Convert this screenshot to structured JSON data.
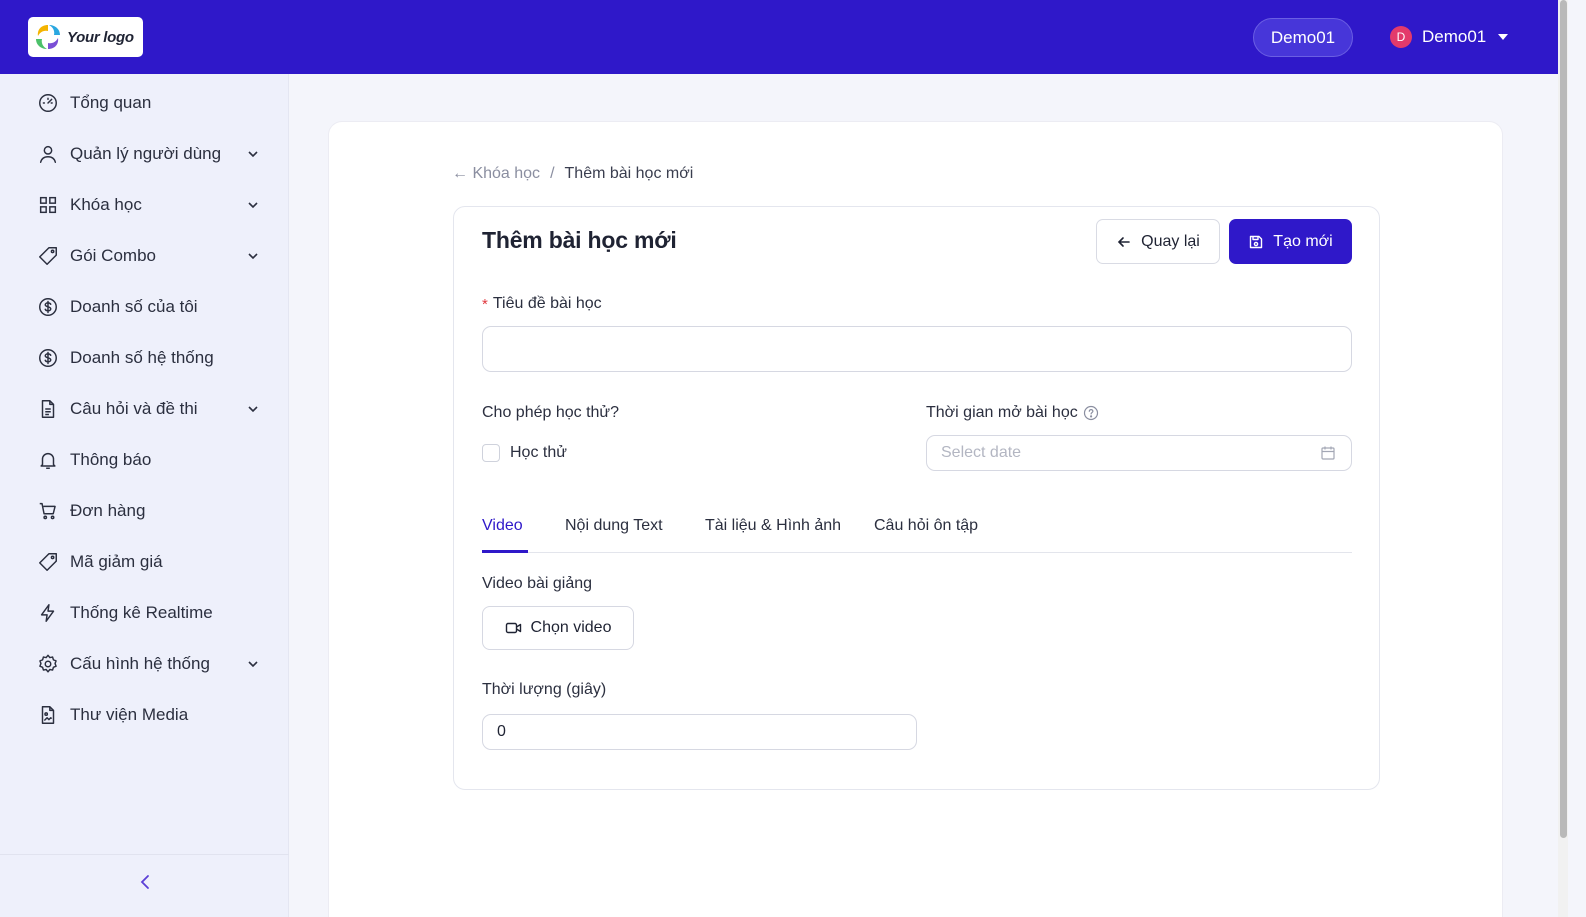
{
  "header": {
    "logo_text": "Your logo",
    "pill_label": "Demo01",
    "user": {
      "initial": "D",
      "name": "Demo01"
    }
  },
  "sidebar": {
    "items": [
      {
        "label": "Tổng quan",
        "icon": "dashboard-icon",
        "expandable": false
      },
      {
        "label": "Quản lý người dùng",
        "icon": "user-icon",
        "expandable": true
      },
      {
        "label": "Khóa học",
        "icon": "grid-icon",
        "expandable": true
      },
      {
        "label": "Gói Combo",
        "icon": "tag-icon",
        "expandable": true
      },
      {
        "label": "Doanh số của tôi",
        "icon": "dollar-icon",
        "expandable": false
      },
      {
        "label": "Doanh số hệ thống",
        "icon": "dollar-icon",
        "expandable": false
      },
      {
        "label": "Câu hỏi và đề thi",
        "icon": "document-icon",
        "expandable": true
      },
      {
        "label": "Thông báo",
        "icon": "bell-icon",
        "expandable": false
      },
      {
        "label": "Đơn hàng",
        "icon": "cart-icon",
        "expandable": false
      },
      {
        "label": "Mã giảm giá",
        "icon": "tag-icon",
        "expandable": false
      },
      {
        "label": "Thống kê Realtime",
        "icon": "lightning-icon",
        "expandable": false
      },
      {
        "label": "Cấu hình hệ thống",
        "icon": "gear-icon",
        "expandable": true
      },
      {
        "label": "Thư viện Media",
        "icon": "media-file-icon",
        "expandable": false
      }
    ]
  },
  "breadcrumb": {
    "parent": "← Khóa học",
    "separator": "/",
    "current": "Thêm bài học mới"
  },
  "form": {
    "title": "Thêm bài học mới",
    "back_label": "Quay lại",
    "create_label": "Tạo mới",
    "title_field": {
      "required_mark": "*",
      "label": "Tiêu đề bài học",
      "value": ""
    },
    "trial": {
      "label": "Cho phép học thử?",
      "checkbox_label": "Học thử",
      "checked": false
    },
    "open_time": {
      "label": "Thời gian mở bài học",
      "placeholder": "Select date"
    },
    "tabs": [
      {
        "label": "Video",
        "active": true
      },
      {
        "label": "Nội dung Text",
        "active": false
      },
      {
        "label": "Tài liệu & Hình ảnh",
        "active": false
      },
      {
        "label": "Câu hỏi ôn tập",
        "active": false
      }
    ],
    "video": {
      "label": "Video bài giảng",
      "button_label": "Chọn video"
    },
    "duration": {
      "label": "Thời lượng (giây)",
      "value": "0"
    }
  },
  "colors": {
    "primary": "#2f18c9",
    "sidebar_bg": "#eef0fb",
    "page_bg": "#f4f5fb",
    "required": "#e0383e",
    "avatar": "#e33a6b"
  }
}
